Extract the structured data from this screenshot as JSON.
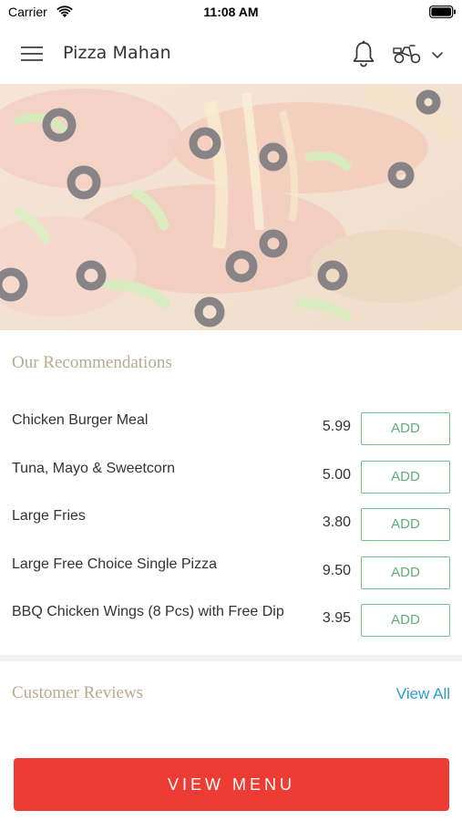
{
  "status_bar": {
    "carrier": "Carrier",
    "time": "11:08 AM",
    "wifi_icon": "wifi-icon",
    "battery_icon": "battery-icon"
  },
  "header": {
    "title": "Pizza Mahan",
    "menu_icon": "hamburger-menu-icon",
    "bell_icon": "bell-icon",
    "delivery_icon": "scooter-icon",
    "dropdown_icon": "chevron-down-icon"
  },
  "hero": {
    "image": "pizza-photo"
  },
  "recommendations": {
    "title": "Our Recommendations",
    "items": [
      {
        "name": "Chicken Burger Meal",
        "price": "5.99",
        "button": "ADD"
      },
      {
        "name": "Tuna, Mayo & Sweetcorn",
        "price": "5.00",
        "button": "ADD"
      },
      {
        "name": "Large Fries",
        "price": "3.80",
        "button": "ADD"
      },
      {
        "name": "Large Free Choice Single Pizza",
        "price": "9.50",
        "button": "ADD"
      },
      {
        "name": "BBQ Chicken Wings (8 Pcs) with Free Dip",
        "price": "3.95",
        "button": "ADD"
      }
    ]
  },
  "reviews": {
    "title": "Customer Reviews",
    "view_all": "View All"
  },
  "cta": {
    "label": "VIEW MENU"
  },
  "colors": {
    "accent_red": "#ec3c33",
    "add_green": "#5fae76",
    "link_blue": "#2b9bd2",
    "section_title": "#b8ac8f"
  }
}
